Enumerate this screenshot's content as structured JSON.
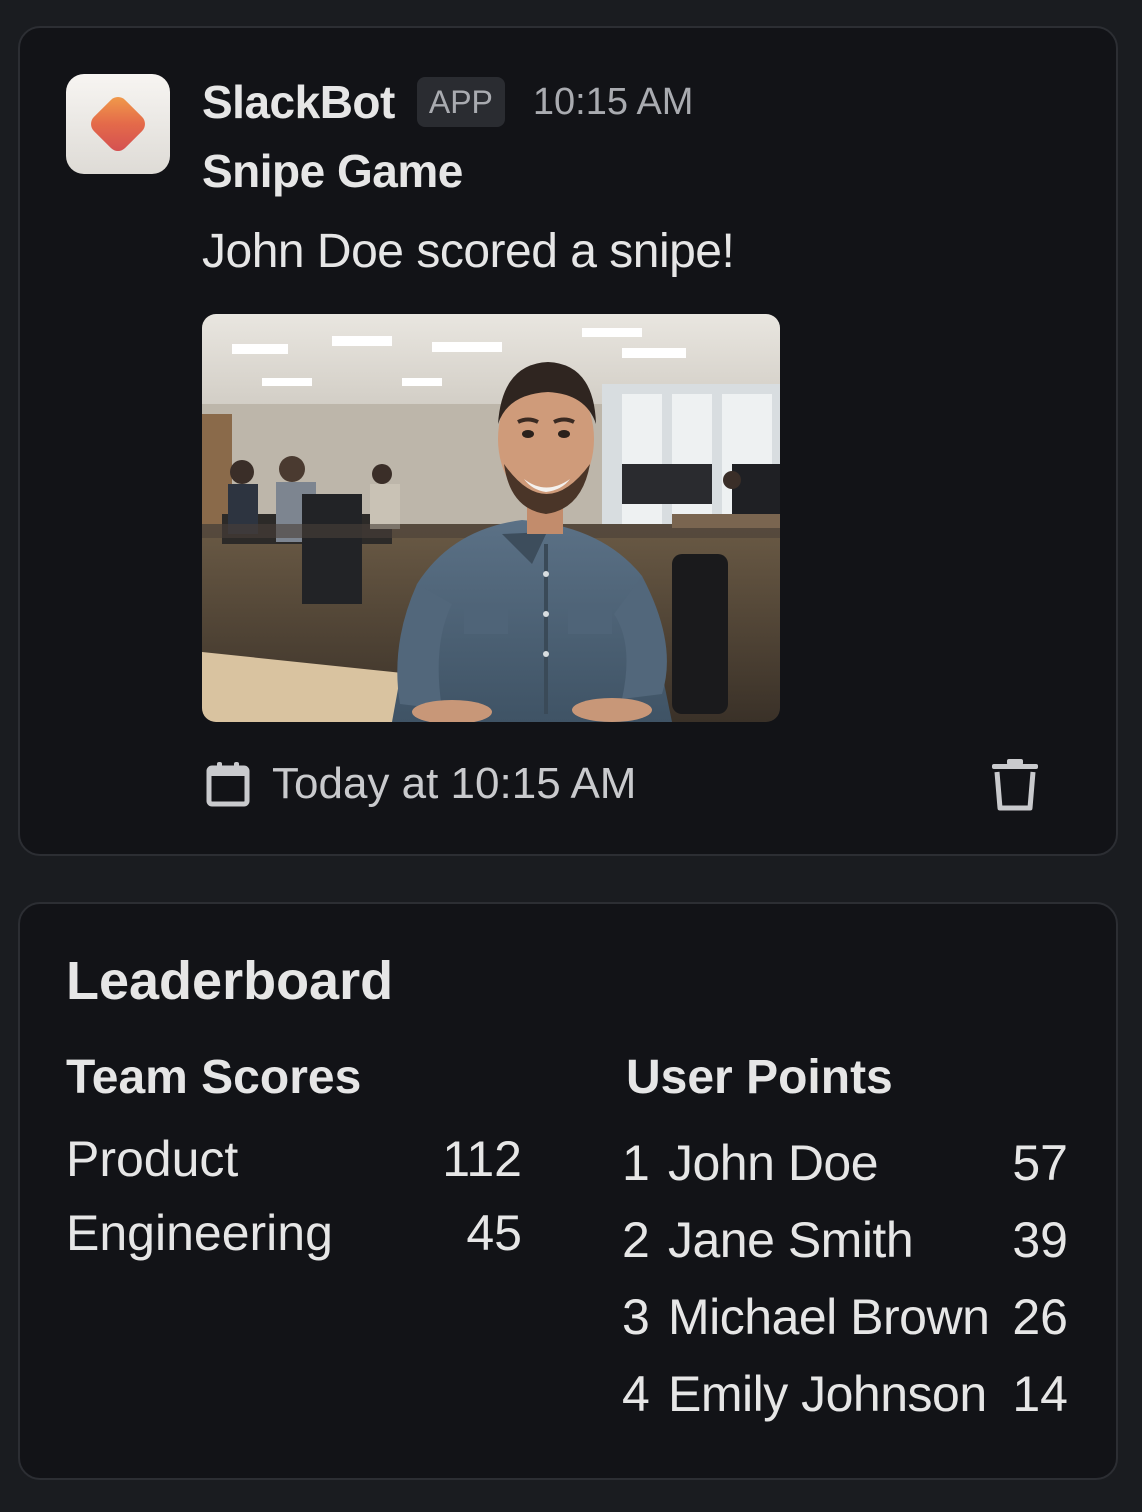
{
  "message": {
    "bot_name": "SlackBot",
    "badge": "APP",
    "time": "10:15 AM",
    "title": "Snipe Game",
    "text": "John Doe scored a snipe!",
    "image_alt": "Smiling man in a denim shirt sitting in an office",
    "footer_date": "Today at 10:15 AM",
    "icons": {
      "app": "slackbot-app-icon",
      "calendar": "calendar-icon",
      "trash": "trash-icon"
    }
  },
  "leaderboard": {
    "title": "Leaderboard",
    "team_heading": "Team Scores",
    "user_heading": "User Points",
    "teams": [
      {
        "name": "Product",
        "score": "112"
      },
      {
        "name": "Engineering",
        "score": "45"
      }
    ],
    "users": [
      {
        "rank": "1",
        "name": "John Doe",
        "points": "57"
      },
      {
        "rank": "2",
        "name": "Jane Smith",
        "points": "39"
      },
      {
        "rank": "3",
        "name": "Michael Brown",
        "points": "26"
      },
      {
        "rank": "4",
        "name": "Emily Johnson",
        "points": "14"
      }
    ]
  },
  "colors": {
    "background": "#1a1c20",
    "card": "#121317",
    "accent": "#e0674a"
  }
}
